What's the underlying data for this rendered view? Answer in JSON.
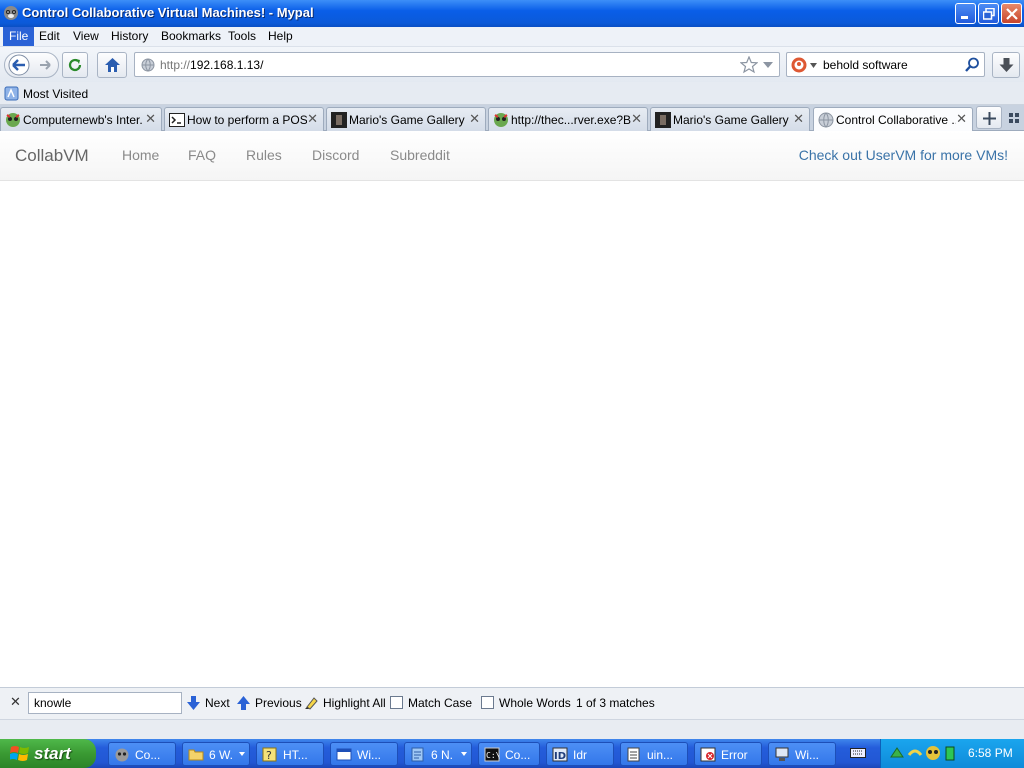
{
  "window": {
    "title": "Control Collaborative Virtual Machines! - Mypal"
  },
  "menu": [
    "File",
    "Edit",
    "View",
    "History",
    "Bookmarks",
    "Tools",
    "Help"
  ],
  "nav": {
    "url_prefix": "http://",
    "url_host": "192.168.1.13/",
    "search_value": "behold software"
  },
  "bookmarks": {
    "most_visited": "Most Visited"
  },
  "tabs": [
    {
      "label": "Computernewb's Inter..."
    },
    {
      "label": "How to perform a POS..."
    },
    {
      "label": "Mario's Game Gallery | ..."
    },
    {
      "label": "http://thec...rver.exe?B"
    },
    {
      "label": "Mario's Game Gallery | ..."
    },
    {
      "label": "Control Collaborative ..."
    }
  ],
  "collabvm": {
    "brand": "CollabVM",
    "links": [
      "Home",
      "FAQ",
      "Rules",
      "Discord",
      "Subreddit"
    ],
    "uservm": "Check out UserVM for more VMs!"
  },
  "findbar": {
    "query": "knowle",
    "next": "Next",
    "previous": "Previous",
    "highlight_all": "Highlight All",
    "match_case": "Match Case",
    "whole_words": "Whole Words",
    "result": "1 of 3 matches"
  },
  "taskbar": {
    "start": "start",
    "items": [
      {
        "label": "Co..."
      },
      {
        "label": "6 W."
      },
      {
        "label": "HT..."
      },
      {
        "label": "Wi..."
      },
      {
        "label": "6 N."
      },
      {
        "label": "Co..."
      },
      {
        "label": "Idr"
      },
      {
        "label": "uin..."
      },
      {
        "label": "Error"
      },
      {
        "label": "Wi..."
      }
    ],
    "clock": "6:58 PM"
  },
  "colors": {
    "accent": "#2a62d6",
    "taskbar": "#245ddb",
    "link": "#3a73a8"
  }
}
